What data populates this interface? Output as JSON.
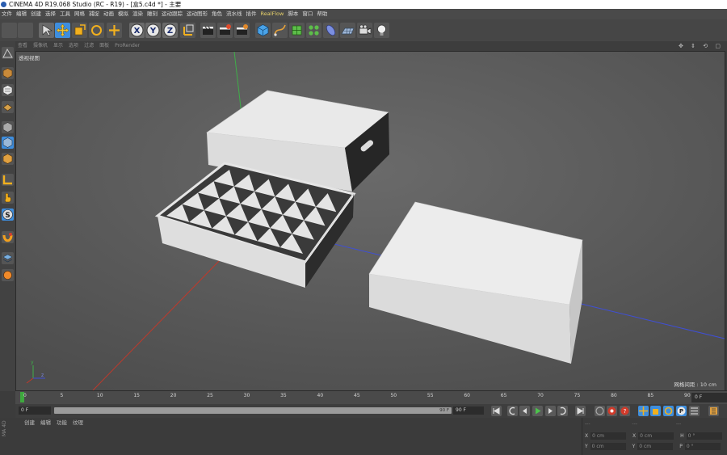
{
  "window_title": "CINEMA 4D R19.068 Studio (RC - R19) - [盒5.c4d *] - 主要",
  "menu": [
    "文件",
    "编辑",
    "创建",
    "选择",
    "工具",
    "网格",
    "捕捉",
    "动画",
    "模拟",
    "渲染",
    "雕刻",
    "运动跟踪",
    "运动图形",
    "角色",
    "流水线",
    "插件",
    "RealFlow",
    "脚本",
    "窗口",
    "帮助"
  ],
  "viewport_menu": [
    "查看",
    "摄像机",
    "显示",
    "选项",
    "过滤",
    "面板",
    "ProRender"
  ],
  "viewport_label": "透视视图",
  "grid_info": "网格间距 : 10 cm",
  "timeline": {
    "ticks": [
      "0",
      "5",
      "10",
      "15",
      "20",
      "25",
      "30",
      "35",
      "40",
      "45",
      "50",
      "55",
      "60",
      "65",
      "70",
      "75",
      "80",
      "85",
      "90"
    ],
    "end_field": "0 F"
  },
  "transport": {
    "current_frame": "0 F",
    "range_end_label": "90 F",
    "max_frame": "90 F"
  },
  "bottom_tabs": [
    "创建",
    "编辑",
    "功能",
    "纹理"
  ],
  "coords": {
    "header": [
      "---",
      "---",
      "---"
    ],
    "rows": [
      {
        "a": "X",
        "a_val": "0 cm",
        "b": "X",
        "b_val": "0 cm",
        "c": "H",
        "c_val": "0 °"
      },
      {
        "a": "Y",
        "a_val": "0 cm",
        "b": "Y",
        "b_val": "0 cm",
        "c": "P",
        "c_val": "0 °"
      }
    ]
  },
  "side_label": "MA 4D",
  "toolbar_icons": [
    "undo-icon",
    "redo-icon",
    "live-select-icon",
    "move-icon",
    "scale-icon",
    "rotate-icon",
    "add-icon",
    "x-axis-icon",
    "y-axis-icon",
    "z-axis-icon",
    "coordinate-system-icon",
    "render-view-icon",
    "render-picture-queue-icon",
    "render-settings-icon",
    "cube-icon",
    "pen-spline-icon",
    "subdivision-icon",
    "cloner-icon",
    "deformer-icon",
    "floor-icon",
    "camera-icon",
    "light-icon"
  ],
  "left_icons": [
    "make-editable-icon",
    "model-mode-icon",
    "texture-mode-icon",
    "points-mode-icon",
    "edges-mode-icon",
    "polygons-mode-icon",
    "axis-mode-icon",
    "snap-icon",
    "enable-axis-icon",
    "magnet-icon",
    "soft-select-icon",
    "layer-icon"
  ],
  "colors": {
    "accent": "#3e8ede",
    "viewport": "#575757",
    "timeline_cursor": "#3ea83e",
    "axis_x": "#c0392b",
    "axis_y": "#3fae49",
    "axis_z": "#3f4fd6"
  }
}
